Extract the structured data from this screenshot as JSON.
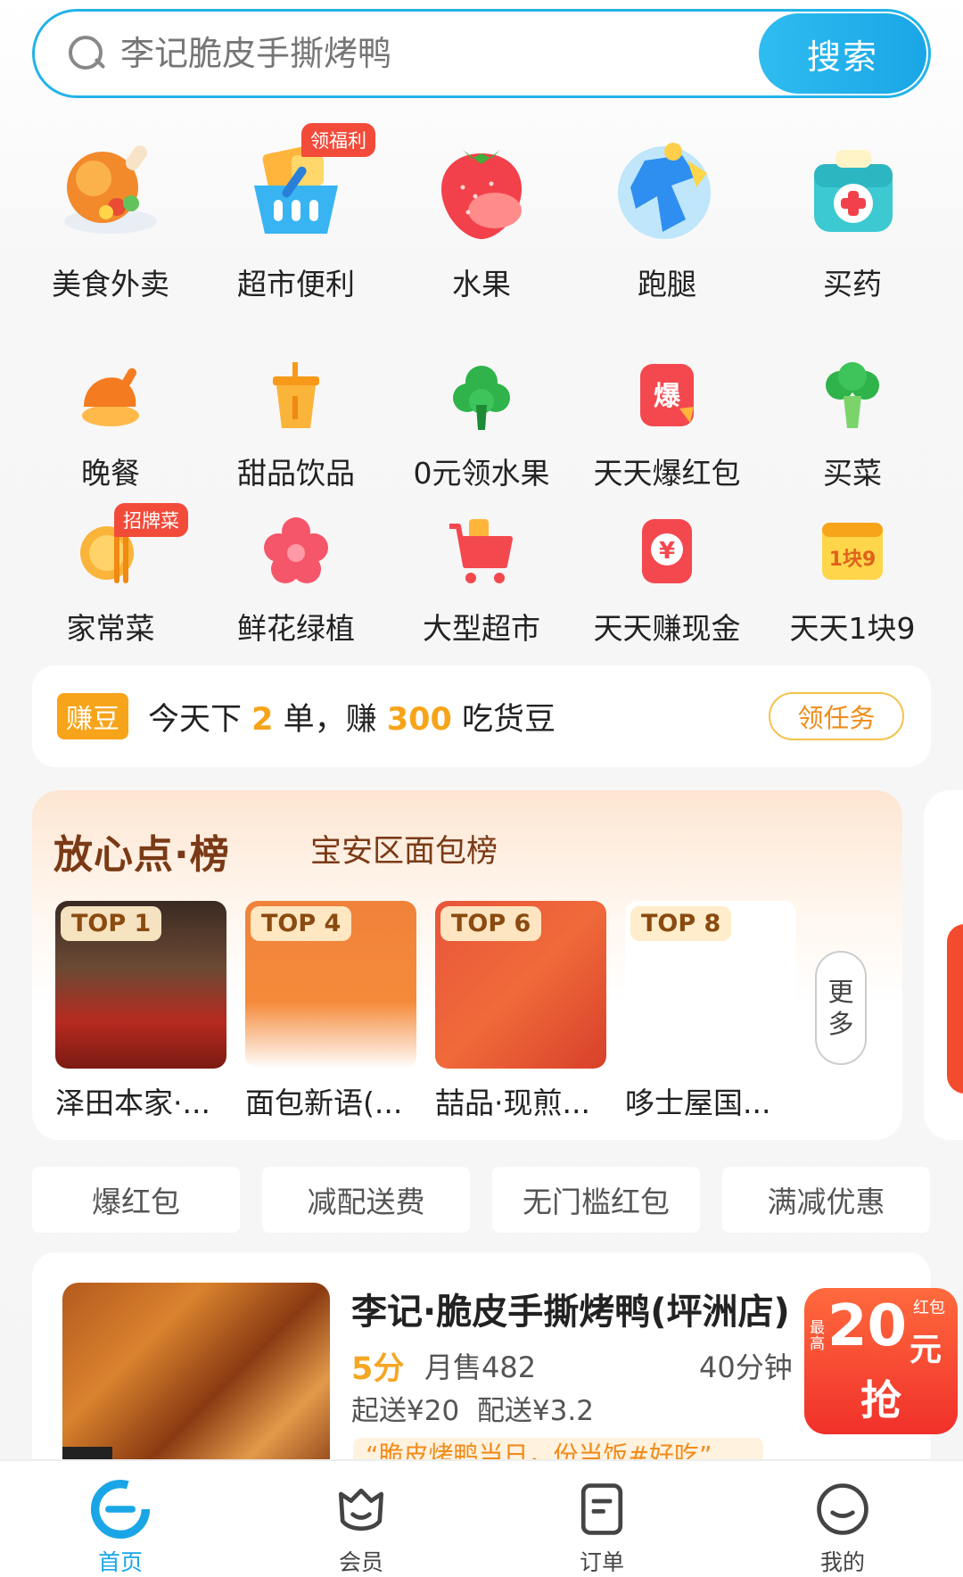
{
  "search": {
    "placeholder": "李记脆皮手撕烤鸭",
    "button": "搜索",
    "accent": "#1aa6e6"
  },
  "categories_big": [
    {
      "label": "美食外卖",
      "icon": "food-delivery-icon"
    },
    {
      "label": "超市便利",
      "icon": "supermarket-basket-icon",
      "badge": "领福利"
    },
    {
      "label": "水果",
      "icon": "strawberry-icon"
    },
    {
      "label": "跑腿",
      "icon": "errand-runner-icon"
    },
    {
      "label": "买药",
      "icon": "medicine-box-icon"
    }
  ],
  "categories_row2": [
    {
      "label": "晚餐",
      "icon": "roast-chicken-icon"
    },
    {
      "label": "甜品饮品",
      "icon": "drink-cup-icon"
    },
    {
      "label": "0元领水果",
      "icon": "tree-icon"
    },
    {
      "label": "天天爆红包",
      "icon": "red-packet-burst-icon"
    },
    {
      "label": "买菜",
      "icon": "broccoli-icon"
    }
  ],
  "categories_row3": [
    {
      "label": "家常菜",
      "icon": "chopsticks-bowl-icon",
      "badge": "招牌菜"
    },
    {
      "label": "鲜花绿植",
      "icon": "flower-icon"
    },
    {
      "label": "大型超市",
      "icon": "shopping-cart-icon"
    },
    {
      "label": "天天赚现金",
      "icon": "yuan-coin-icon"
    },
    {
      "label": "天天1块9",
      "icon": "one-yuan-nine-icon",
      "icon_text": "1块9"
    }
  ],
  "bean": {
    "chip": "赚豆",
    "text_a": "今天下",
    "num_a": "2",
    "text_b": "单，赚",
    "num_b": "300",
    "text_c": "吃货豆",
    "task": "领任务"
  },
  "rank": {
    "title": "放心点·榜",
    "subtitle": "宝安区面包榜",
    "items": [
      {
        "top": "TOP 1",
        "name": "泽田本家·..."
      },
      {
        "top": "TOP 4",
        "name": "面包新语(..."
      },
      {
        "top": "TOP 6",
        "name": "喆品·现煎..."
      },
      {
        "top": "TOP 8",
        "name": "哆士屋国..."
      }
    ],
    "more": "更多"
  },
  "filters": [
    "爆红包",
    "减配送费",
    "无门槛红包",
    "满减优惠"
  ],
  "shop": {
    "name": "李记·脆皮手撕烤鸭(坪洲店)",
    "score": "5分",
    "sales": "月售482",
    "time": "40分钟",
    "min_order": "起送¥20",
    "delivery": "配送¥3.2",
    "promo": "“脆皮烤鸭当日，份当饭#好吃”"
  },
  "redpack": {
    "amount": "20",
    "unit": "元",
    "small1": "红包",
    "small2": "最高",
    "grab": "抢"
  },
  "nav": [
    {
      "label": "首页",
      "icon": "ele-home-icon",
      "active": true
    },
    {
      "label": "会员",
      "icon": "member-icon"
    },
    {
      "label": "订单",
      "icon": "order-icon"
    },
    {
      "label": "我的",
      "icon": "profile-icon"
    }
  ]
}
